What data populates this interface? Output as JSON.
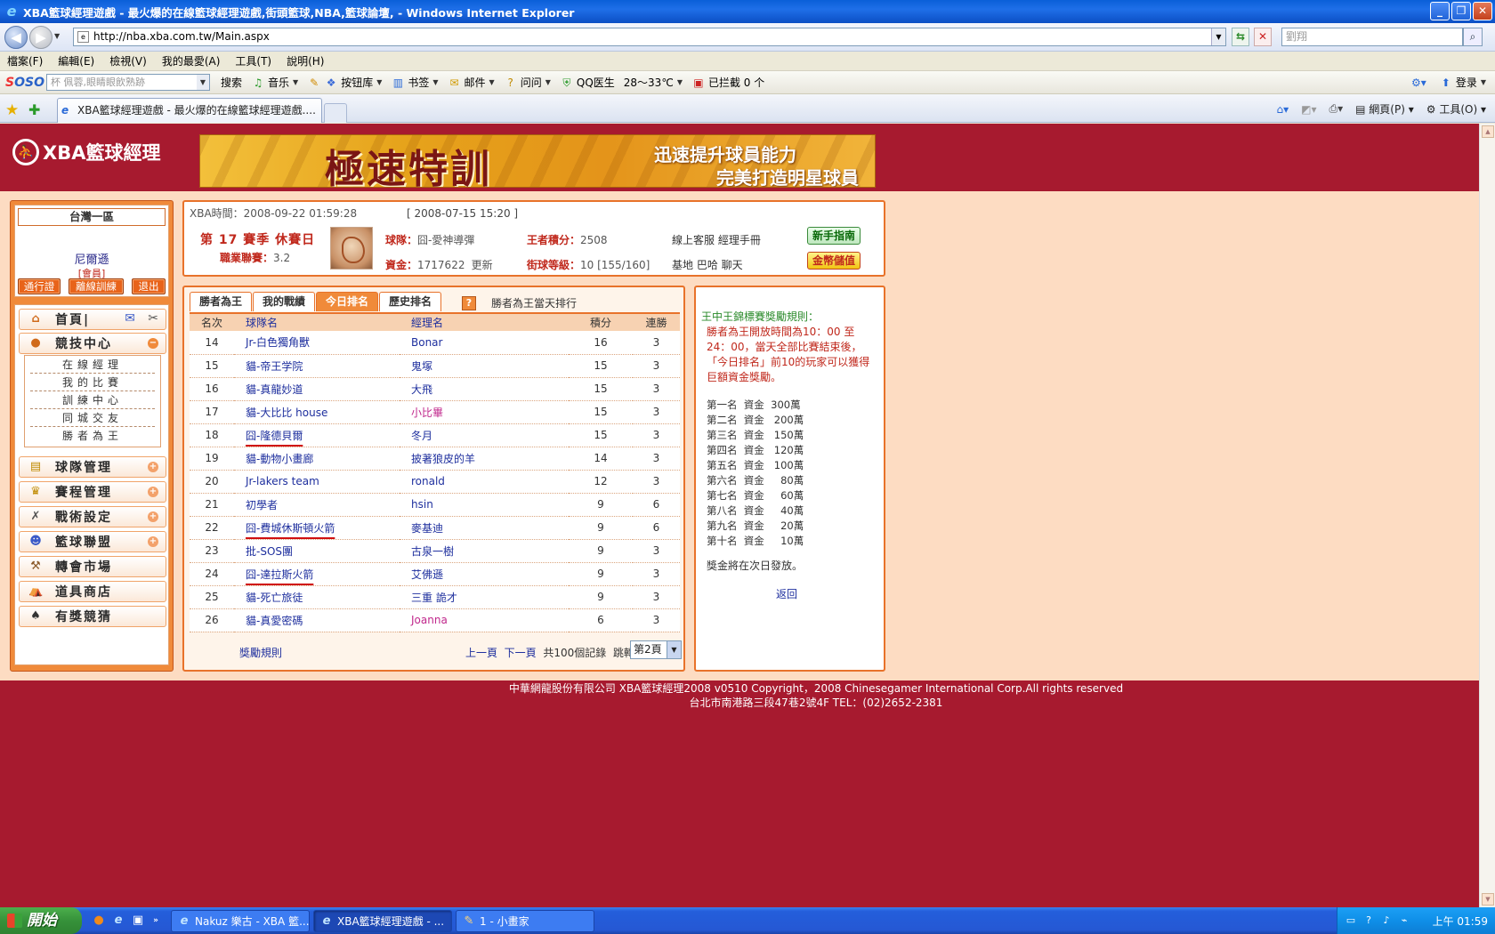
{
  "window": {
    "title": "XBA籃球經理遊戲 - 最火爆的在線籃球經理遊戲,街頭籃球,NBA,籃球論壇, - Windows Internet Explorer",
    "min": "_",
    "max": "❐",
    "close": "✕"
  },
  "address": {
    "url": "http://nba.xba.com.tw/Main.aspx",
    "search_placeholder": "劉翔"
  },
  "menu": [
    "檔案(F)",
    "編輯(E)",
    "檢視(V)",
    "我的最愛(A)",
    "工具(T)",
    "說明(H)"
  ],
  "soso": {
    "logo_a": "S",
    "logo_b": "OSO",
    "search_placeholder": "杯  佩蓉,眼睛眼飲熟跡",
    "items": [
      "搜索",
      "音乐",
      "按钮库",
      "书签",
      "邮件",
      "问问",
      "QQ医生",
      "28～33℃",
      "已拦截 0 个"
    ],
    "right": [
      "登录"
    ]
  },
  "tab": {
    "title": "XBA籃球經理遊戲 - 最火爆的在線籃球經理遊戲....",
    "cmd_page": "網頁(P)",
    "cmd_tools": "工具(O)"
  },
  "site": {
    "logo": "XBA籃球經理",
    "banner_big": "極速特訓",
    "banner_l1": "迅速提升球員能力",
    "banner_l2": "完美打造明星球員"
  },
  "user": {
    "server": "台灣一區",
    "name": "尼爾遜",
    "role": "[會員]",
    "buttons": [
      "通行證",
      "離線訓練",
      "退出"
    ]
  },
  "nav": {
    "home": "首頁|",
    "arena": "競技中心",
    "sub": [
      "在線經理",
      "我的比賽",
      "訓練中心",
      "同城交友",
      "勝者為王"
    ],
    "team": "球隊管理",
    "schedule": "賽程管理",
    "tactics": "戰術設定",
    "league": "籃球聯盟",
    "transfer": "轉會市場",
    "shop": "道具商店",
    "lottery": "有獎競猜"
  },
  "info": {
    "xba_time_label": "XBA時間：",
    "xba_time": "2008-09-22 01:59:28",
    "stamp": "[ 2008-07-15 15:20 ]",
    "season": "第 17 賽季  休賽日",
    "career_label": "職業聯賽：",
    "career_value": "3.2",
    "team_label": "球隊：",
    "team_value": "囧-愛神導彈",
    "funds_label": "資金：",
    "funds_value": "1717622",
    "update": "更新",
    "king_label": "王者積分：",
    "king_value": "2508",
    "street_label": "街球等級：",
    "street_value": "10 [155/160]",
    "links1": "線上客服  經理手冊",
    "links2": "基地  巴哈  聊天",
    "guide_btn": "新手指南",
    "money_btn": "金幣儲值"
  },
  "ranking": {
    "tabs": [
      "勝者為王",
      "我的戰績",
      "今日排名",
      "歷史排名"
    ],
    "active_tab": 2,
    "caption": "勝者為王當天排行",
    "headers": [
      "名次",
      "球隊名",
      "經理名",
      "積分",
      "連勝"
    ],
    "rows": [
      {
        "no": "14",
        "team": "Jr-白色獨角獸",
        "mgr": "Bonar",
        "pts": "16",
        "win": "3"
      },
      {
        "no": "15",
        "team": "貓-帝王学院",
        "mgr": "鬼塚",
        "pts": "15",
        "win": "3"
      },
      {
        "no": "16",
        "team": "貓-真龍妙道",
        "mgr": "大飛",
        "pts": "15",
        "win": "3"
      },
      {
        "no": "17",
        "team": "貓-大比比  house",
        "mgr": "小比畢",
        "pts": "15",
        "win": "3"
      },
      {
        "no": "18",
        "team": "囧-隆德貝爾",
        "mgr": "冬月",
        "pts": "15",
        "win": "3"
      },
      {
        "no": "19",
        "team": "貓-動物小畫廊",
        "mgr": "披著狼皮的羊",
        "pts": "14",
        "win": "3"
      },
      {
        "no": "20",
        "team": "Jr-lakers   team",
        "mgr": "ronald",
        "pts": "12",
        "win": "3"
      },
      {
        "no": "21",
        "team": "初學者",
        "mgr": "hsin",
        "pts": "9",
        "win": "6"
      },
      {
        "no": "22",
        "team": "囧-費城休斯頓火箭",
        "mgr": "麥基迪",
        "pts": "9",
        "win": "6"
      },
      {
        "no": "23",
        "team": "批-SOS團",
        "mgr": "古泉一樹",
        "pts": "9",
        "win": "3"
      },
      {
        "no": "24",
        "team": "囧-達拉斯火箭",
        "mgr": "艾佛遜",
        "pts": "9",
        "win": "3"
      },
      {
        "no": "25",
        "team": "貓-死亡旅徒",
        "mgr": "三重  詭才",
        "pts": "9",
        "win": "3"
      },
      {
        "no": "26",
        "team": "貓-真愛密碼",
        "mgr": "Joanna",
        "pts": "6",
        "win": "3"
      }
    ],
    "rules_link": "獎勵規則",
    "prev": "上一頁",
    "next": "下一頁",
    "total": "共100個記錄",
    "jump": "跳轉",
    "page_select": "第2頁"
  },
  "rules": {
    "title": "王中王錦標賽獎勵規則：",
    "text": "勝者為王開放時間為10：00 至24：00，當天全部比賽結束後，「今日排名」前10的玩家可以獲得巨額資金獎勵。",
    "prizes": [
      "第一名  資金  300萬",
      "第二名  資金   200萬",
      "第三名  資金   150萬",
      "第四名  資金   120萬",
      "第五名  資金   100萬",
      "第六名  資金     80萬",
      "第七名  資金     60萬",
      "第八名  資金     40萬",
      "第九名  資金     20萬",
      "第十名  資金     10萬"
    ],
    "note": "獎金將在次日發放。",
    "back": "返回"
  },
  "footer": {
    "line1": "中華網龍股份有限公司  XBA籃球經理2008 v0510     Copyright，2008 Chinesegamer International Corp.All rights reserved",
    "line2": "台北市南港路三段47巷2號4F TEL：(02)2652-2381"
  },
  "taskbar": {
    "start": "開始",
    "tasks": [
      "Nakuz 樂古 - XBA 籃...",
      "XBA籃球經理遊戲 - ...",
      "1 - 小畫家"
    ],
    "clock": "上午 01:59"
  }
}
